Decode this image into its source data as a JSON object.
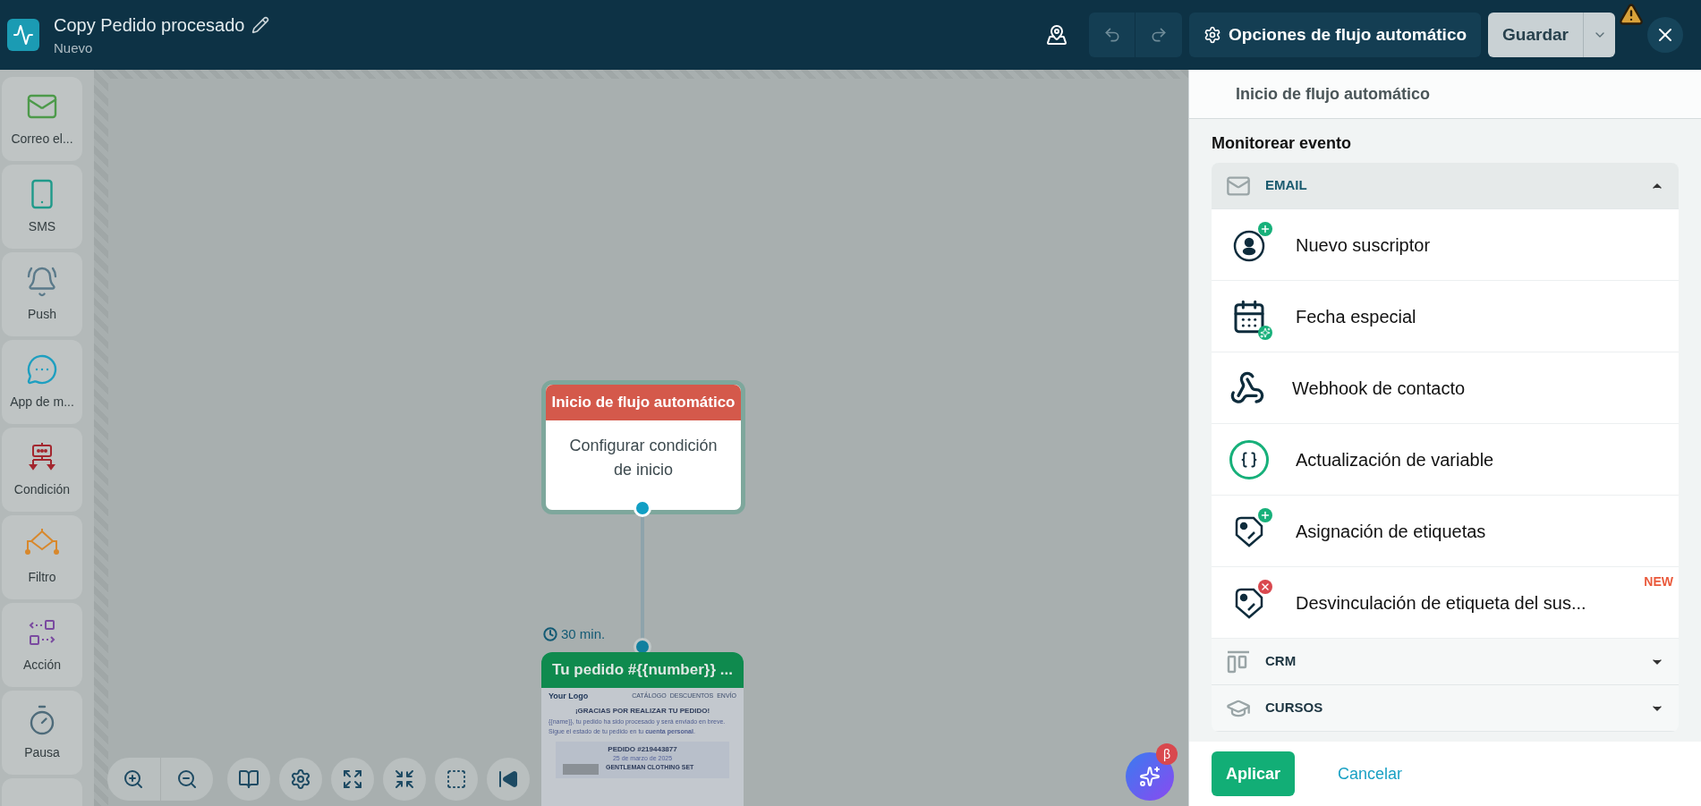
{
  "header": {
    "title": "Copy Pedido procesado",
    "subtitle": "Nuevo",
    "options_button": "Opciones de flujo automático",
    "save_button": "Guardar"
  },
  "sidebar": {
    "items": [
      {
        "kind": "email",
        "label": "Correo el..."
      },
      {
        "kind": "sms",
        "label": "SMS"
      },
      {
        "kind": "push",
        "label": "Push"
      },
      {
        "kind": "app",
        "label": "App de m..."
      },
      {
        "kind": "condition",
        "label": "Condición"
      },
      {
        "kind": "filter",
        "label": "Filtro"
      },
      {
        "kind": "action",
        "label": "Acción"
      },
      {
        "kind": "pause",
        "label": "Pausa"
      },
      {
        "kind": "list"
      }
    ]
  },
  "canvas": {
    "nodes": [
      {
        "kind": "start",
        "title": "Inicio de flujo automático",
        "body": "Configurar condición de inicio"
      },
      {
        "kind": "email",
        "delay": "30 min.",
        "title": "Tu pedido #{{number}} ...",
        "preview": {
          "logo": "Your **Logo**",
          "menu": [
            "CATÁLOGO",
            "DESCUENTOS",
            "ENVÍO"
          ],
          "heading": "¡GRACIAS POR REALIZAR TU PEDIDO!",
          "lines": [
            "{{name}}, tu pedido ha sido procesado y será enviado en breve.",
            "Sigue el estado de tu pedido en tu **cuenta personal**."
          ],
          "order": "PEDIDO #219443877",
          "date": "25 de marzo de 2025",
          "product": "GENTLEMAN CLOTHING SET"
        }
      }
    ]
  },
  "ai_button": {
    "badge": "β"
  },
  "panel": {
    "title": "Inicio de flujo automático",
    "section": "Monitorear evento",
    "groups": [
      {
        "kind": "email",
        "label": "EMAIL",
        "expanded": true,
        "events": [
          {
            "kind": "subscriber",
            "label": "Nuevo suscriptor"
          },
          {
            "kind": "date",
            "label": "Fecha especial"
          },
          {
            "kind": "webhook",
            "label": "Webhook de contacto"
          },
          {
            "kind": "variable",
            "label": "Actualización de variable"
          },
          {
            "kind": "tag_add",
            "label": "Asignación de etiquetas"
          },
          {
            "kind": "tag_remove",
            "label": "Desvinculación de etiqueta del sus...",
            "badge": "NEW"
          }
        ]
      },
      {
        "kind": "crm",
        "label": "CRM",
        "expanded": false
      },
      {
        "kind": "courses",
        "label": "CURSOS",
        "expanded": false
      }
    ],
    "apply_button": "Aplicar",
    "cancel_button": "Cancelar"
  }
}
